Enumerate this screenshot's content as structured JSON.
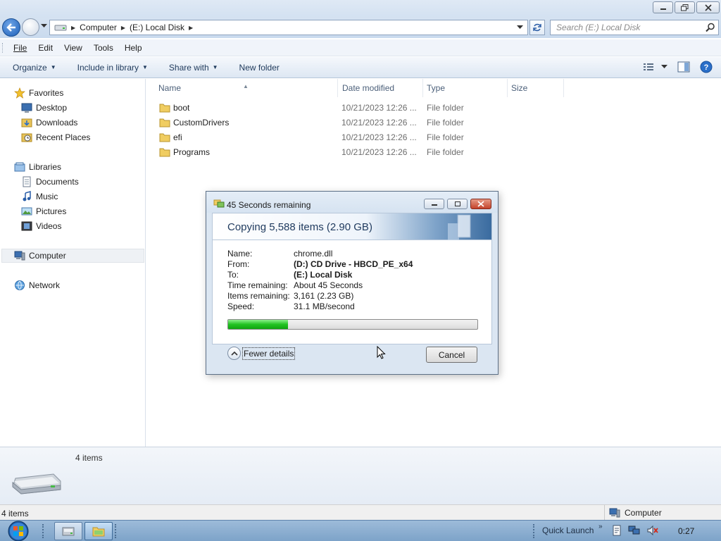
{
  "window": {
    "buttons": [
      "minimize-icon",
      "restore-icon",
      "close-icon"
    ]
  },
  "address": {
    "crumbs": [
      "Computer",
      "(E:) Local Disk"
    ],
    "search_placeholder": "Search (E:) Local Disk"
  },
  "menu": {
    "items": [
      "File",
      "Edit",
      "View",
      "Tools",
      "Help"
    ]
  },
  "commands": {
    "items": [
      {
        "label": "Organize",
        "dropdown": true
      },
      {
        "label": "Include in library",
        "dropdown": true
      },
      {
        "label": "Share with",
        "dropdown": true
      },
      {
        "label": "New folder",
        "dropdown": false
      }
    ]
  },
  "nav": {
    "favorites": "Favorites",
    "desktop": "Desktop",
    "downloads": "Downloads",
    "recent": "Recent Places",
    "libraries": "Libraries",
    "documents": "Documents",
    "music": "Music",
    "pictures": "Pictures",
    "videos": "Videos",
    "computer": "Computer",
    "network": "Network"
  },
  "columns": {
    "name": "Name",
    "date": "Date modified",
    "type": "Type",
    "size": "Size"
  },
  "files": [
    {
      "name": "boot",
      "date": "10/21/2023 12:26 ...",
      "type": "File folder"
    },
    {
      "name": "CustomDrivers",
      "date": "10/21/2023 12:26 ...",
      "type": "File folder"
    },
    {
      "name": "efi",
      "date": "10/21/2023 12:26 ...",
      "type": "File folder"
    },
    {
      "name": "Programs",
      "date": "10/21/2023 12:26 ...",
      "type": "File folder"
    }
  ],
  "details": {
    "count": "4 items"
  },
  "status": {
    "left": "4 items",
    "right": "Computer"
  },
  "taskbar": {
    "quick_launch": "Quick Launch",
    "clock": "0:27"
  },
  "dialog": {
    "title": "45 Seconds remaining",
    "heading": "Copying 5,588 items (2.90 GB)",
    "fields": [
      {
        "key": "Name:",
        "value": "chrome.dll",
        "bold": false
      },
      {
        "key": "From:",
        "value": "(D:) CD Drive - HBCD_PE_x64",
        "bold": true
      },
      {
        "key": "To:",
        "value": "(E:) Local Disk",
        "bold": true
      },
      {
        "key": "Time remaining:",
        "value": "About 45 Seconds",
        "bold": false
      },
      {
        "key": "Items remaining:",
        "value": "3,161 (2.23 GB)",
        "bold": false
      },
      {
        "key": "Speed:",
        "value": "31.1 MB/second",
        "bold": false
      }
    ],
    "progress_percent": 24,
    "fewer_details": "Fewer details",
    "cancel": "Cancel"
  },
  "colors": {
    "progress": "#22c322",
    "accent": "#1d5fb8"
  }
}
